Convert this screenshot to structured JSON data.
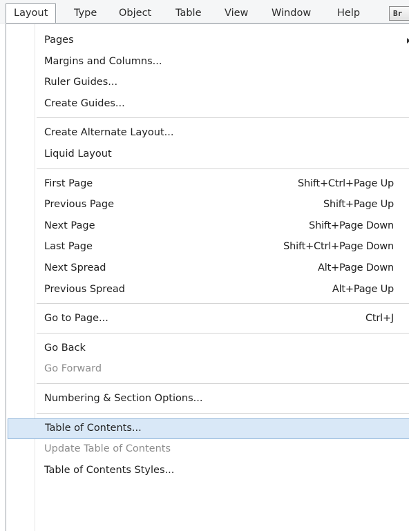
{
  "menubar": {
    "items": [
      "Layout",
      "Type",
      "Object",
      "Table",
      "View",
      "Window",
      "Help"
    ],
    "bridge_label": "Br"
  },
  "dropdown": {
    "groups": [
      [
        {
          "label": "Pages",
          "shortcut": "",
          "submenu": true
        },
        {
          "label": "Margins and Columns...",
          "shortcut": ""
        },
        {
          "label": "Ruler Guides...",
          "shortcut": ""
        },
        {
          "label": "Create Guides...",
          "shortcut": ""
        }
      ],
      [
        {
          "label": "Create Alternate Layout...",
          "shortcut": ""
        },
        {
          "label": "Liquid Layout",
          "shortcut": ""
        }
      ],
      [
        {
          "label": "First Page",
          "shortcut": "Shift+Ctrl+Page Up"
        },
        {
          "label": "Previous Page",
          "shortcut": "Shift+Page Up"
        },
        {
          "label": "Next Page",
          "shortcut": "Shift+Page Down"
        },
        {
          "label": "Last Page",
          "shortcut": "Shift+Ctrl+Page Down"
        },
        {
          "label": "Next Spread",
          "shortcut": "Alt+Page Down"
        },
        {
          "label": "Previous Spread",
          "shortcut": "Alt+Page Up"
        }
      ],
      [
        {
          "label": "Go to Page...",
          "shortcut": "Ctrl+J"
        }
      ],
      [
        {
          "label": "Go Back",
          "shortcut": ""
        },
        {
          "label": "Go Forward",
          "shortcut": "",
          "disabled": true
        }
      ],
      [
        {
          "label": "Numbering & Section Options...",
          "shortcut": ""
        }
      ],
      [
        {
          "label": "Table of Contents...",
          "shortcut": "",
          "highlighted": true
        },
        {
          "label": "Update Table of Contents",
          "shortcut": "",
          "disabled": true
        },
        {
          "label": "Table of Contents Styles...",
          "shortcut": ""
        }
      ]
    ]
  },
  "colors": {
    "highlight_fill": "#d9e8f7",
    "highlight_border": "#8db3d9",
    "disabled_text": "#8d8d8d"
  }
}
